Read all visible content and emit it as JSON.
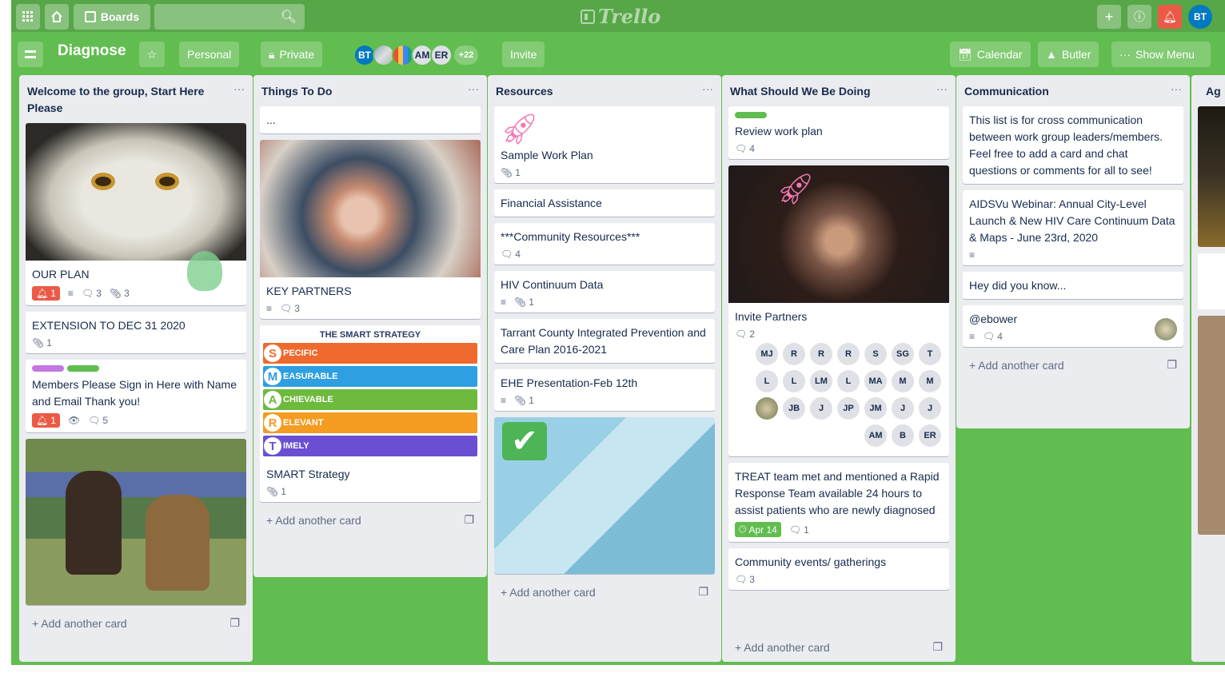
{
  "topbar": {
    "boards_label": "Boards",
    "logo_text": "Trello",
    "avatar_initials": "BT"
  },
  "board": {
    "title": "Diagnose",
    "team_label": "Personal",
    "visibility_label": "Private",
    "members": [
      "BT",
      "AM",
      "ER"
    ],
    "member_more": "+22",
    "invite_label": "Invite",
    "calendar_label": "Calendar",
    "butler_label": "Butler",
    "show_menu_label": "Show Menu"
  },
  "add_card_label": "+ Add another card",
  "lists": {
    "welcome": {
      "title": "Welcome to the group, Start Here Please",
      "cards": {
        "plan": {
          "title": "OUR PLAN",
          "notif": "1",
          "comments": "3",
          "attachments": "3"
        },
        "ext": {
          "title": "EXTENSION TO DEC 31 2020",
          "attachments": "1"
        },
        "members": {
          "title": "Members Please Sign in Here with Name and Email Thank you!",
          "notif": "1",
          "comments": "5"
        }
      }
    },
    "todo": {
      "title": "Things To Do",
      "cards": {
        "dots": {
          "title": "..."
        },
        "partners": {
          "title": "KEY PARTNERS",
          "comments": "3"
        },
        "smart": {
          "title": "SMART Strategy",
          "attachments": "1",
          "image_title": "THE SMART STRATEGY",
          "rows": [
            {
              "letter": "S",
              "word": "PECIFIC",
              "color": "#ef6a2e"
            },
            {
              "letter": "M",
              "word": "EASURABLE",
              "color": "#2e9fe0"
            },
            {
              "letter": "A",
              "word": "CHIEVABLE",
              "color": "#6dba3d"
            },
            {
              "letter": "R",
              "word": "ELEVANT",
              "color": "#f39c21"
            },
            {
              "letter": "T",
              "word": "IMELY",
              "color": "#6a4fd3"
            }
          ]
        }
      }
    },
    "resources": {
      "title": "Resources",
      "cards": {
        "sample": {
          "title": "Sample Work Plan",
          "attachments": "1"
        },
        "financial": {
          "title": "Financial Assistance"
        },
        "community": {
          "title": "***Community Resources***",
          "comments": "4"
        },
        "hiv": {
          "title": "HIV Continuum Data",
          "attachments": "1"
        },
        "tarrant": {
          "title": "Tarrant County Integrated Prevention and Care Plan 2016-2021"
        },
        "ehe": {
          "title": "EHE Presentation-Feb 12th",
          "attachments": "1"
        }
      }
    },
    "what": {
      "title": "What Should We Be Doing",
      "cards": {
        "review": {
          "title": "Review work plan",
          "comments": "4"
        },
        "invite": {
          "title": "Invite Partners",
          "comments": "2",
          "members": [
            "MJ",
            "R",
            "R",
            "R",
            "S",
            "SG",
            "T",
            "L",
            "L",
            "LM",
            "L",
            "MA",
            "M",
            "M",
            "",
            "JB",
            "J",
            "JP",
            "JM",
            "J",
            "J",
            "AM",
            "B",
            "ER"
          ]
        },
        "treat": {
          "title": "TREAT team met and mentioned a Rapid Response Team available 24 hours to assist patients who are newly diagnosed",
          "due": "Apr 14",
          "comments": "1"
        },
        "events": {
          "title": "Community events/ gatherings",
          "comments": "3"
        }
      }
    },
    "communication": {
      "title": "Communication",
      "cards": {
        "intro": {
          "title": "This list is for cross communication between work group leaders/members. Feel free to add a card and chat questions or comments for all to see!"
        },
        "aidsvu": {
          "title": "AIDSVu Webinar: Annual City-Level Launch & New HIV Care Continuum Data & Maps - June 23rd, 2020"
        },
        "didyou": {
          "title": "Hey did you know..."
        },
        "ebower": {
          "title": "@ebower",
          "comments": "4"
        }
      }
    },
    "partial": {
      "title": "Ag"
    }
  }
}
